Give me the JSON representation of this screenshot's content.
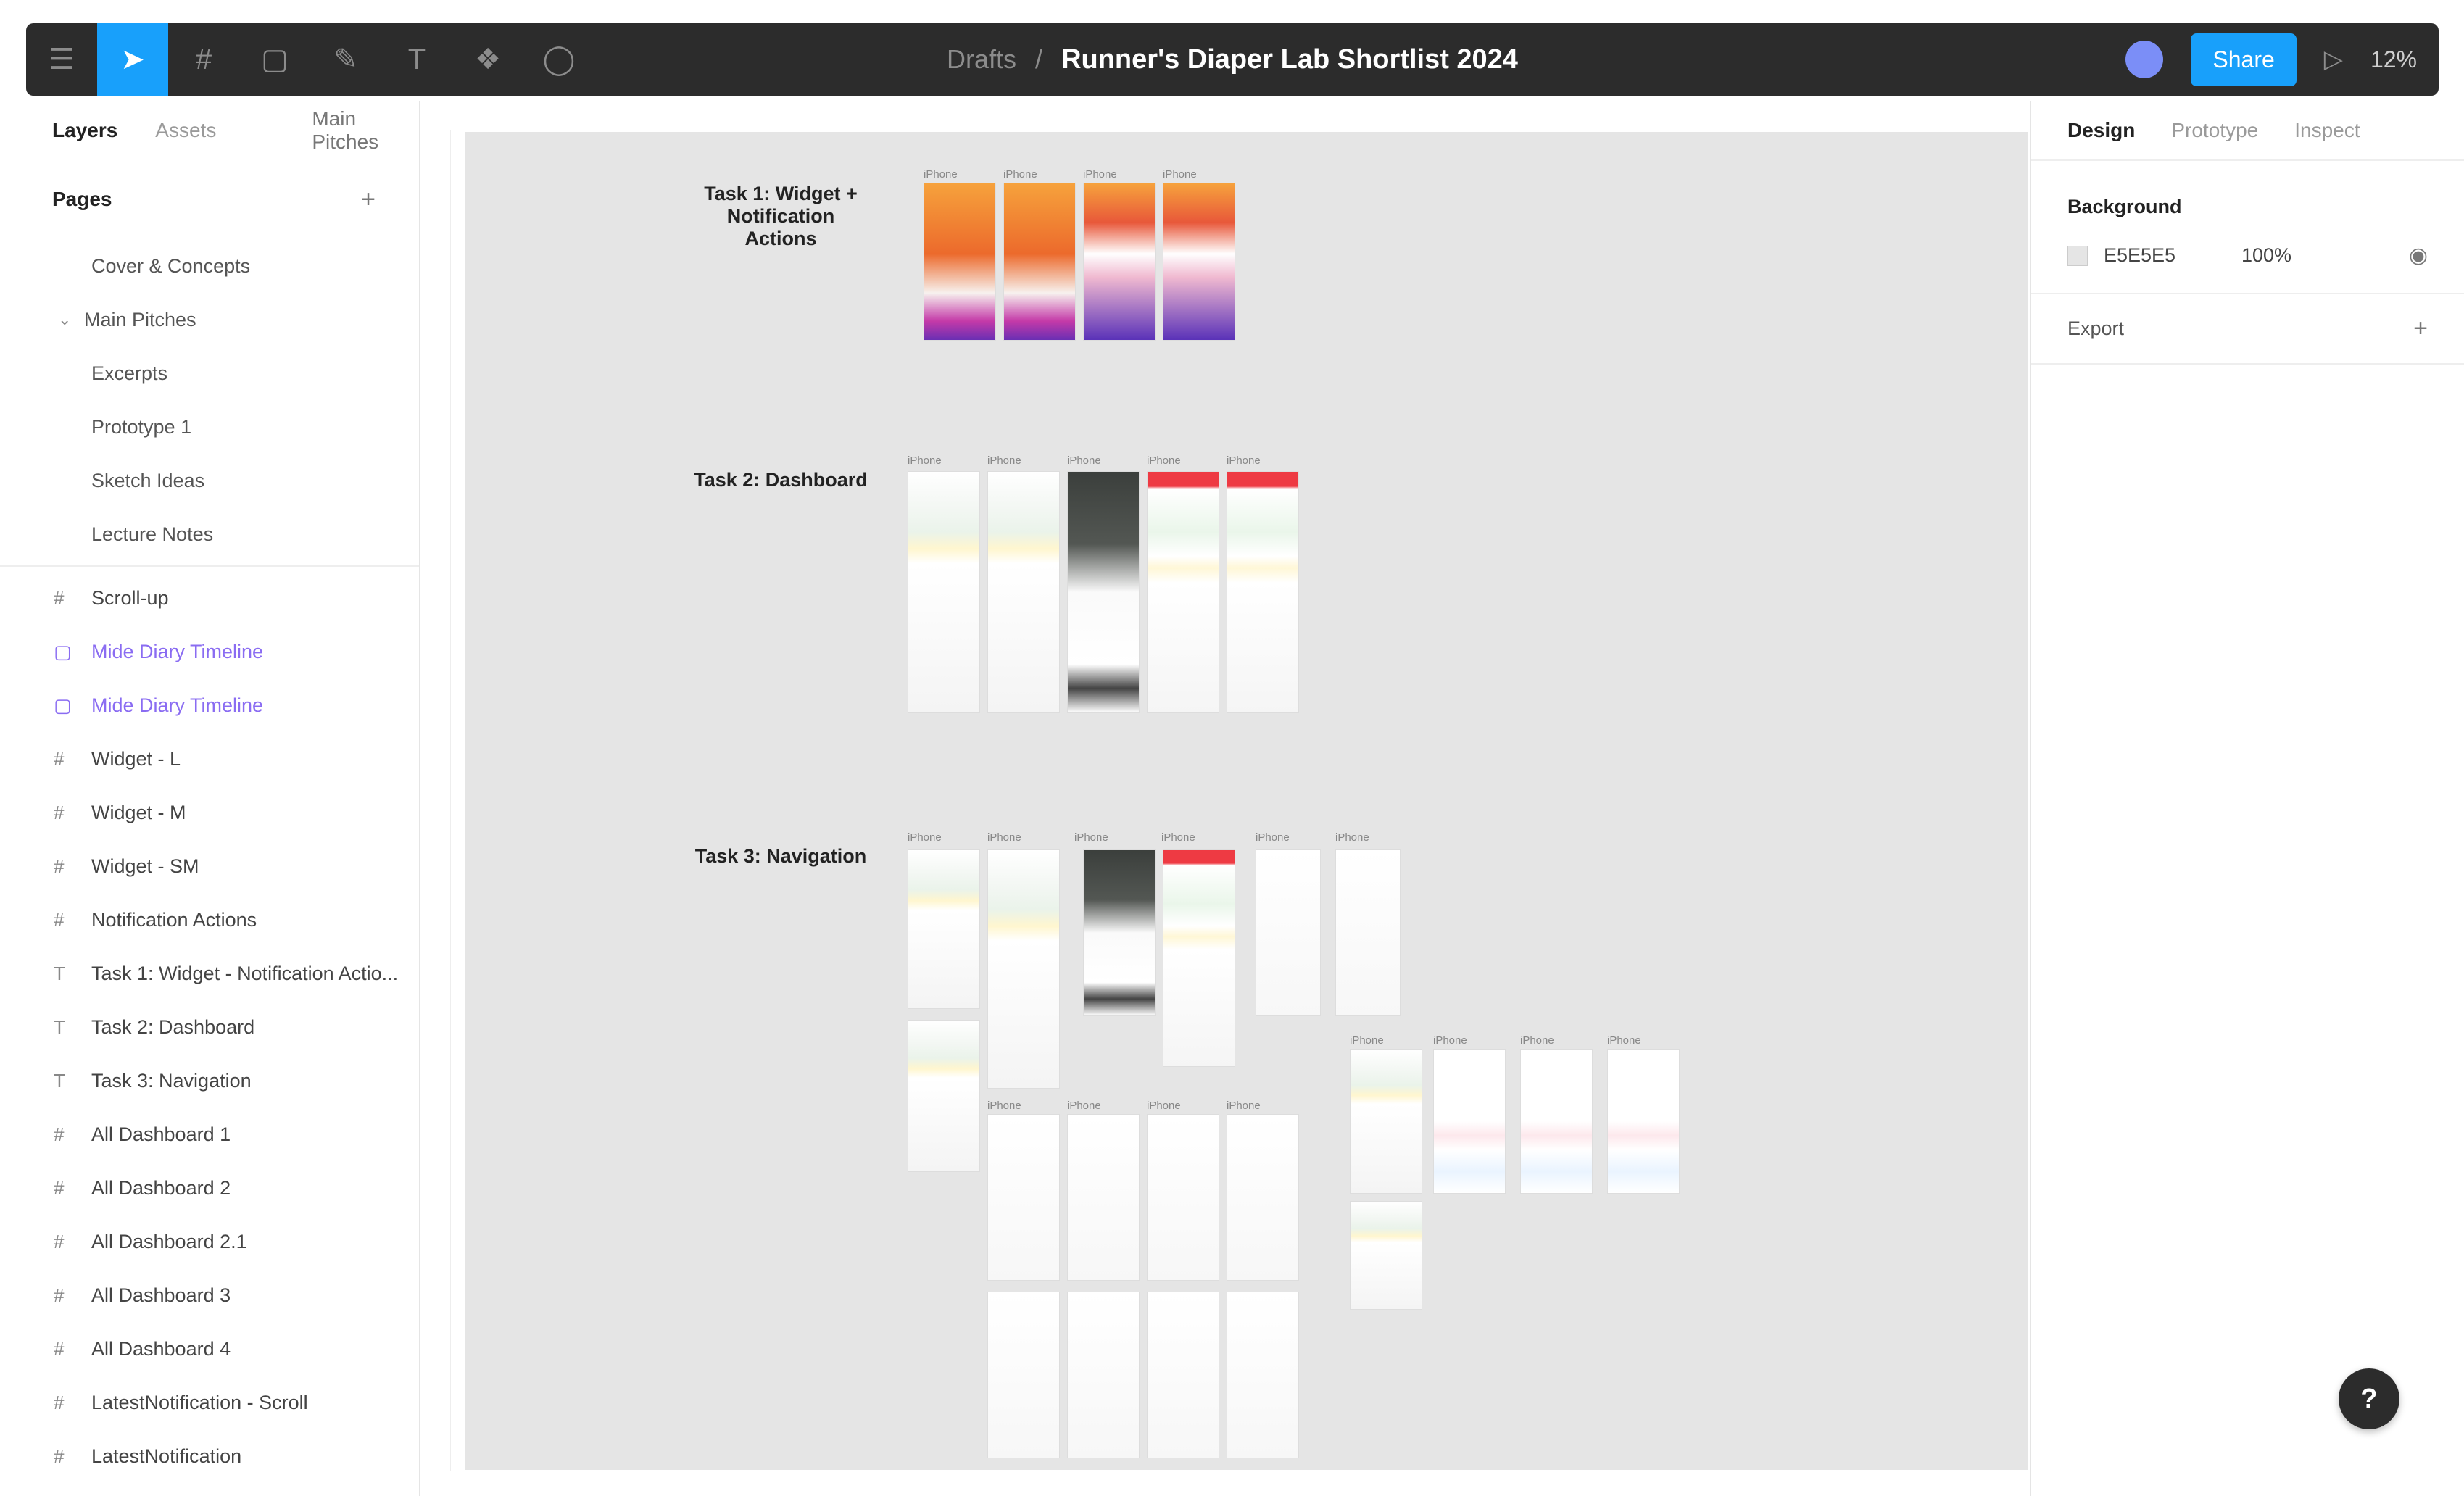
{
  "toolbar": {
    "tools": [
      {
        "name": "main-menu-icon",
        "glyph": "☰"
      },
      {
        "name": "move-tool-icon",
        "glyph": "➤"
      },
      {
        "name": "frame-tool-icon",
        "glyph": "#"
      },
      {
        "name": "shape-tool-icon",
        "glyph": "▢"
      },
      {
        "name": "pen-tool-icon",
        "glyph": "✎"
      },
      {
        "name": "text-tool-icon",
        "glyph": "T"
      },
      {
        "name": "components-icon",
        "glyph": "❖"
      },
      {
        "name": "comment-tool-icon",
        "glyph": "◯"
      }
    ],
    "folder": "Drafts",
    "separator": "/",
    "file_name": "Runner's Diaper Lab Shortlist 2024",
    "share_label": "Share",
    "play_glyph": "▷",
    "zoom_label": "12%"
  },
  "left_panel": {
    "tabs": {
      "layers": "Layers",
      "assets": "Assets",
      "page": "Main Pitches"
    },
    "pages_title": "Pages",
    "add_page": "+",
    "pages": [
      {
        "label": "Cover & Concepts",
        "kind": "item"
      },
      {
        "label": "Main Pitches",
        "kind": "group"
      },
      {
        "label": "Excerpts",
        "kind": "item"
      },
      {
        "label": "Prototype 1",
        "kind": "item"
      },
      {
        "label": "Sketch Ideas",
        "kind": "item"
      },
      {
        "label": "Lecture Notes",
        "kind": "item"
      }
    ],
    "layers": [
      {
        "label": "Scroll-up",
        "icon": "#",
        "selected": false
      },
      {
        "label": "Mide Diary Timeline",
        "icon": "▢",
        "selected": true
      },
      {
        "label": "Mide Diary Timeline",
        "icon": "▢",
        "selected": true
      },
      {
        "label": "Widget - L",
        "icon": "#",
        "selected": false
      },
      {
        "label": "Widget - M",
        "icon": "#",
        "selected": false
      },
      {
        "label": "Widget - SM",
        "icon": "#",
        "selected": false
      },
      {
        "label": "Notification Actions",
        "icon": "#",
        "selected": false
      },
      {
        "label": "Task 1: Widget - Notification Actio...",
        "icon": "T",
        "selected": false
      },
      {
        "label": "Task 2: Dashboard",
        "icon": "T",
        "selected": false
      },
      {
        "label": "Task 3: Navigation",
        "icon": "T",
        "selected": false
      },
      {
        "label": "All Dashboard 1",
        "icon": "#",
        "selected": false
      },
      {
        "label": "All Dashboard 2",
        "icon": "#",
        "selected": false
      },
      {
        "label": "All Dashboard 2.1",
        "icon": "#",
        "selected": false
      },
      {
        "label": "All Dashboard 3",
        "icon": "#",
        "selected": false
      },
      {
        "label": "All Dashboard 4",
        "icon": "#",
        "selected": false
      },
      {
        "label": "LatestNotification - Scroll",
        "icon": "#",
        "selected": false
      },
      {
        "label": "LatestNotification",
        "icon": "#",
        "selected": false
      }
    ]
  },
  "canvas": {
    "bg_color": "#E5E5E5",
    "sections": [
      {
        "label": "Task 1: Widget + Notification Actions"
      },
      {
        "label": "Task 2: Dashboard"
      },
      {
        "label": "Task 3: Navigation"
      }
    ],
    "frame_title": "iPhone"
  },
  "right_panel": {
    "tabs": {
      "design": "Design",
      "prototype": "Prototype",
      "inspect": "Inspect"
    },
    "background_title": "Background",
    "bg_hex": "E5E5E5",
    "bg_opacity": "100%",
    "export_label": "Export",
    "add_glyph": "+",
    "eye_glyph": "◉"
  },
  "help": {
    "label": "?"
  }
}
